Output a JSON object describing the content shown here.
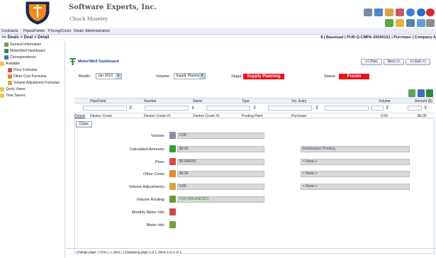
{
  "header": {
    "company": "Software Experts, Inc.",
    "user": "Chuck Moseley"
  },
  "menu": [
    "Contracts",
    "Pipes/Fields",
    "Pricing/Costs",
    "Deals",
    "Administration"
  ],
  "breadcrumb": ">> Deals > Deal > Detail",
  "path_info": "8 | Baseload | PUR-Q-CMPA-20090101 | Purchase | Company A",
  "sidebar": {
    "items": [
      "General Information",
      "Meter/Well Dashboard",
      "Correspondence",
      "Available",
      "Price Formulas",
      "Other Cost Formulas",
      "Volume Adjustment Formulas",
      "Quick Views",
      "Time Savers"
    ]
  },
  "dashboard": {
    "title": "Meter/Well Dashboard",
    "nav": {
      "prev": "<< Prev",
      "next": "Next >>",
      "exit": "<< Exit >>"
    },
    "month_label": "Month:",
    "month_value": "Jan-2010",
    "volume_label": "Volume:",
    "volume_value": "Supply Planning",
    "stage_label": "Stage:",
    "stage_value": "Supply Planning",
    "status_label": "Status:",
    "status_value": "Frozen",
    "colors": {
      "stage_bg": "#e8131b",
      "status_bg": "#e8131b"
    }
  },
  "grid": {
    "headers": [
      "Pipe/Field",
      "Number",
      "Name",
      "Type",
      "Vol. Entry",
      "Volume",
      "Amount ($)"
    ],
    "row": {
      "details": "Details",
      "pipe_field": "Denton Creek",
      "number": "Denton Creek #1",
      "name": "Denton Creek #1",
      "type": "Pooling Point",
      "vol_entry": "Purchase",
      "volume": "0.00",
      "amount": "$0.00"
    },
    "close_label": "Close"
  },
  "detail": {
    "volume_label": "Volume:",
    "volume_value": "0.00",
    "calc_label": "Calculated Amounts:",
    "calc_value": "$0.00",
    "calc_note": "Initialization Pending",
    "price_label": "Price:",
    "price_value": "$0.000000",
    "price_formula": "< None >",
    "other_label": "Other Costs:",
    "other_value": "$0.00",
    "other_formula": "< None >",
    "vadj_label": "Volume Adjustments:",
    "vadj_value": "0.00",
    "vadj_formula": "< None >",
    "routing_label": "Volume Routing:",
    "routing_value": "0.00  (BALANCED)",
    "monthly_label": "Monthly Meter Info:",
    "meter_label": "Meter Info:"
  },
  "pager": "Change page: < Prev > < Next >  |  Displaying page 1 of 1, items 1 to 1 of 1."
}
